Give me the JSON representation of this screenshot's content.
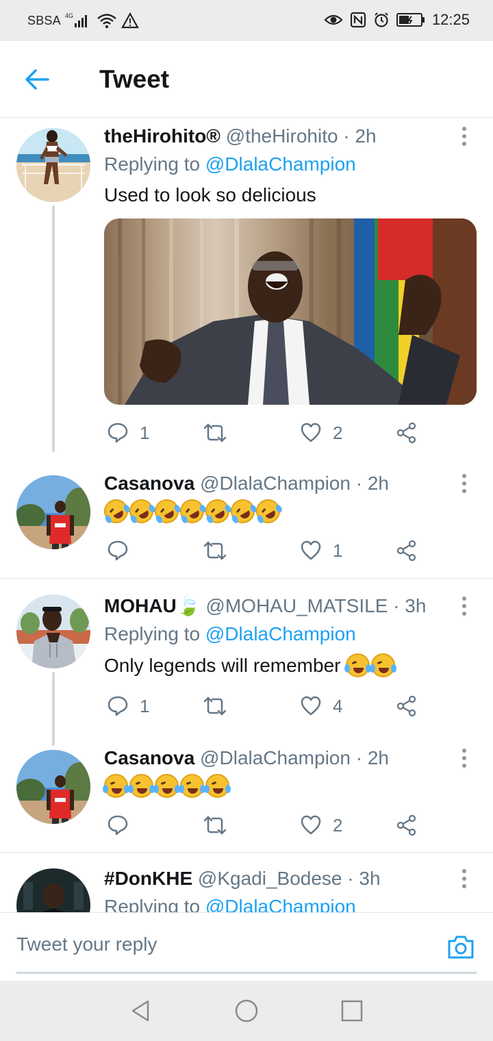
{
  "status_bar": {
    "carrier": "SBSA",
    "network": "4G",
    "time": "12:25"
  },
  "header": {
    "title": "Tweet"
  },
  "tweets": [
    {
      "name": "theHirohito®",
      "handle": "@theHirohito",
      "time": "2h",
      "replying_prefix": "Replying to",
      "replying_to": "@DlalaChampion",
      "text": "Used to look so delicious",
      "replies": "1",
      "retweets": "",
      "likes": "2"
    },
    {
      "name": "Casanova",
      "handle": "@DlalaChampion",
      "time": "2h",
      "text": "🤣🤣🤣🤣🤣🤣🤣",
      "emoji_count": 7,
      "replies": "",
      "retweets": "",
      "likes": "1"
    },
    {
      "name": "MOHAU🍃",
      "handle": "@MOHAU_MATSILE",
      "time": "3h",
      "replying_prefix": "Replying to",
      "replying_to": "@DlalaChampion",
      "text": "Only legends will remember",
      "text_emoji_count": 2,
      "replies": "1",
      "retweets": "",
      "likes": "4"
    },
    {
      "name": "Casanova",
      "handle": "@DlalaChampion",
      "time": "2h",
      "text": "😂😂😂😂😂",
      "emoji_count": 5,
      "replies": "",
      "retweets": "",
      "likes": "2"
    },
    {
      "name": "#DonKHE",
      "handle": "@Kgadi_Bodese",
      "time": "3h",
      "replying_prefix": "Replying to",
      "replying_to": "@DlalaChampion"
    }
  ],
  "reply_bar": {
    "placeholder": "Tweet your reply"
  },
  "colors": {
    "accent": "#1da1f2",
    "secondary_text": "#657786",
    "primary_text": "#14171a"
  },
  "icons": [
    "back-arrow-icon",
    "more-vertical-icon",
    "reply-icon",
    "retweet-icon",
    "like-icon",
    "share-icon",
    "camera-icon",
    "nav-back-icon",
    "nav-home-icon",
    "nav-recents-icon"
  ]
}
